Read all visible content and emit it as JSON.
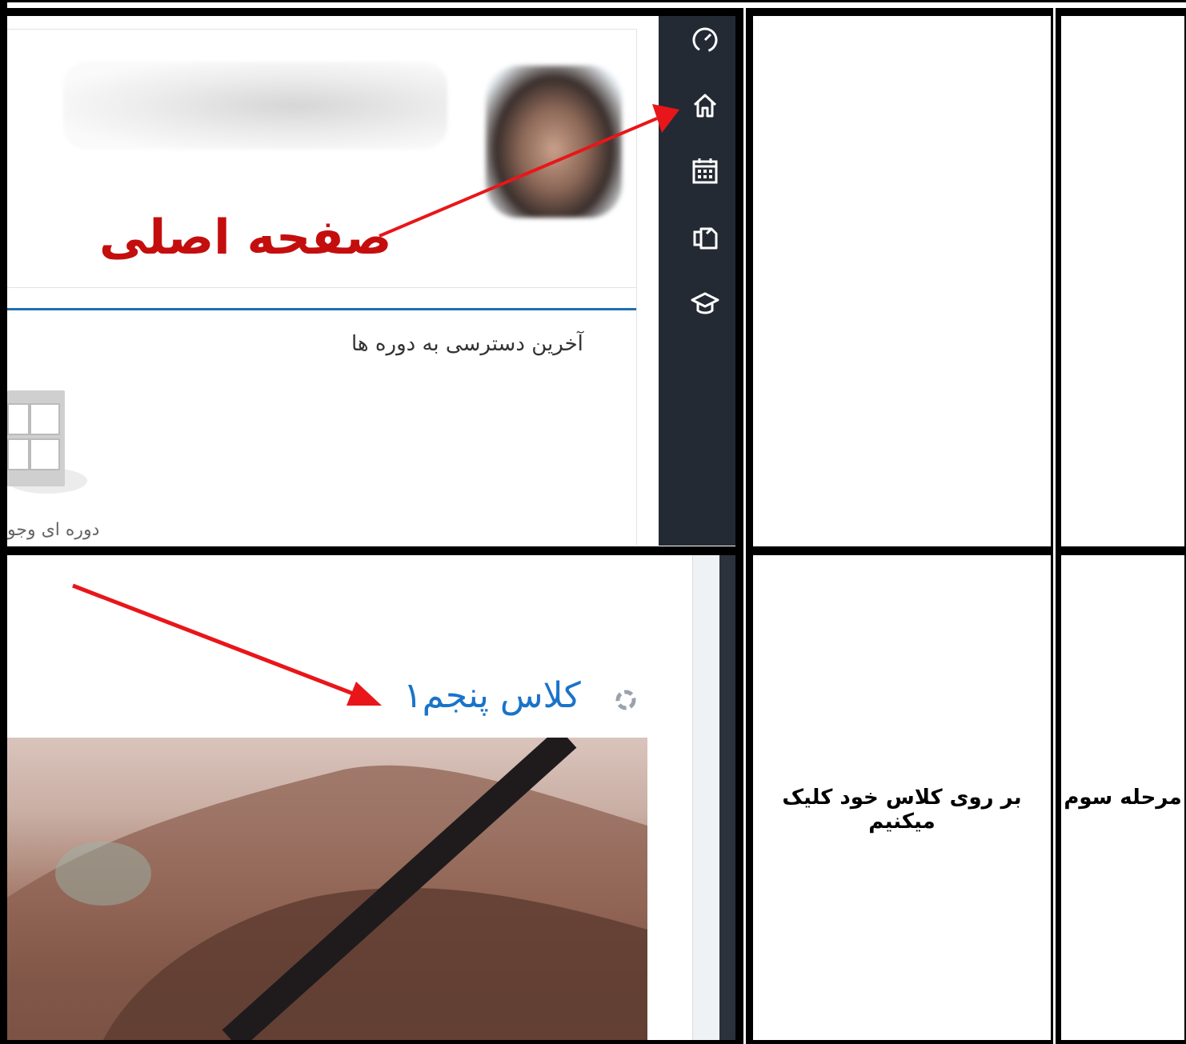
{
  "row1": {
    "annotation": "صفحه اصلی",
    "recent_courses_title": "آخرین دسترسی به دوره ها",
    "no_course_text": "دوره ای وجو",
    "sidebar_icons": [
      "dashboard-icon",
      "home-icon",
      "calendar-icon",
      "files-icon",
      "graduation-cap-icon"
    ]
  },
  "row2": {
    "class_link": "کلاس پنجم۱",
    "instruction": "بر روی کلاس خود کلیک میکنیم",
    "step": "مرحله سوم"
  },
  "colors": {
    "annotation_red": "#c40e0e",
    "arrow_red": "#e8161a",
    "sidebar_dark": "#232a33",
    "link_blue": "#1a73c9"
  }
}
